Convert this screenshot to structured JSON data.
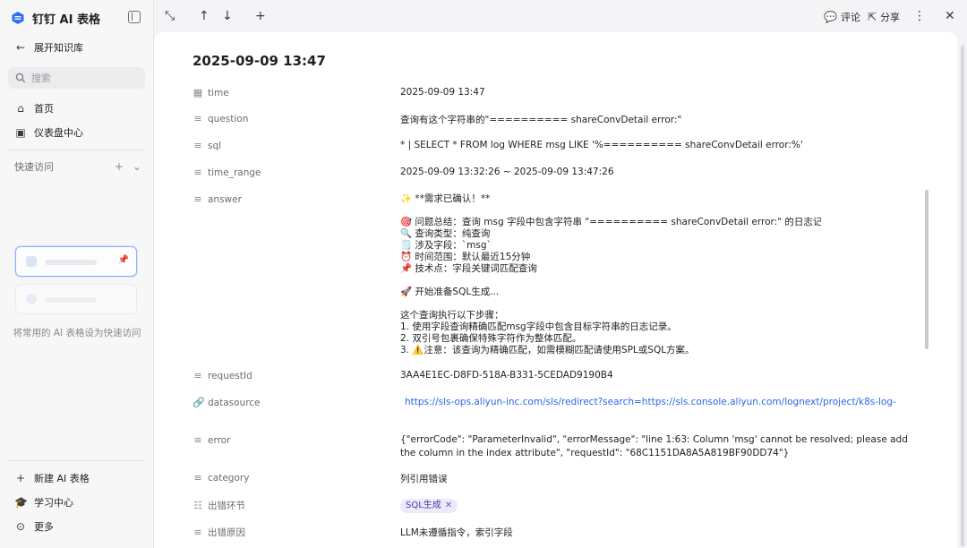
{
  "brand": {
    "title": "钉钉 AI 表格"
  },
  "sidebar": {
    "expand_label": "展开知识库",
    "search_placeholder": "搜索",
    "nav": [
      {
        "label": "首页",
        "icon": "home-icon"
      },
      {
        "label": "仪表盘中心",
        "icon": "dashboard-icon"
      }
    ],
    "quick_access": {
      "label": "快速访问",
      "hint": "将常用的 AI 表格设为快速访问"
    },
    "bottom": [
      {
        "label": "新建 AI 表格",
        "icon": "plus-icon"
      },
      {
        "label": "学习中心",
        "icon": "graduation-cap-icon"
      },
      {
        "label": "更多",
        "icon": "more-circle-icon"
      }
    ]
  },
  "toolbar": {
    "comment_label": "评论",
    "share_label": "分享"
  },
  "record": {
    "title": "2025-09-09 13:47",
    "fields": {
      "time": {
        "name": "time",
        "value": "2025-09-09 13:47"
      },
      "question": {
        "name": "question",
        "value": "查询有这个字符串的\"========== shareConvDetail error:\""
      },
      "sql": {
        "name": "sql",
        "value": "* | SELECT * FROM log WHERE msg LIKE '%========== shareConvDetail error:%'"
      },
      "time_range": {
        "name": "time_range",
        "value": "2025-09-09 13:32:26 ~ 2025-09-09 13:47:26"
      },
      "answer": {
        "name": "answer",
        "lines": [
          "✨ **需求已确认！**",
          "",
          "🎯 问题总结：查询 msg 字段中包含字符串 \"========== shareConvDetail error:\" 的日志记录",
          "🔍 查询类型：纯查询",
          "🗒️ 涉及字段：`msg`",
          "⏰ 时间范围：默认最近15分钟",
          "📌 技术点：字段关键词匹配查询",
          "",
          "🚀 开始准备SQL生成...",
          "",
          "这个查询执行以下步骤：",
          "1. 使用字段查询精确匹配msg字段中包含目标字符串的日志记录。",
          "2. 双引号包裹确保特殊字符作为整体匹配。",
          "3. ⚠️注意：该查询为精确匹配，如需模糊匹配请使用SPL或SQL方案。"
        ]
      },
      "requestId": {
        "name": "requestId",
        "value": "3AA4E1EC-D8FD-518A-B331-5CEDAD9190B4"
      },
      "datasource": {
        "name": "datasource",
        "value": "https://sls-ops.aliyun-inc.com/sls/redirect?search=https://sls.console.aliyun.com/lognext/project/k8s-log-"
      },
      "error": {
        "name": "error",
        "value": "{\"errorCode\": \"ParameterInvalid\", \"errorMessage\": \"line 1:63: Column 'msg' cannot be resolved; please add the column in the index attribute\", \"requestId\": \"68C1151DA8A5A819BF90DD74\"}"
      },
      "category": {
        "name": "category",
        "value": "列引用错误"
      },
      "error_stage": {
        "name": "出错环节",
        "tag": "SQL生成"
      },
      "error_reason": {
        "name": "出错原因",
        "value": "LLM未遵循指令，索引字段"
      }
    }
  }
}
